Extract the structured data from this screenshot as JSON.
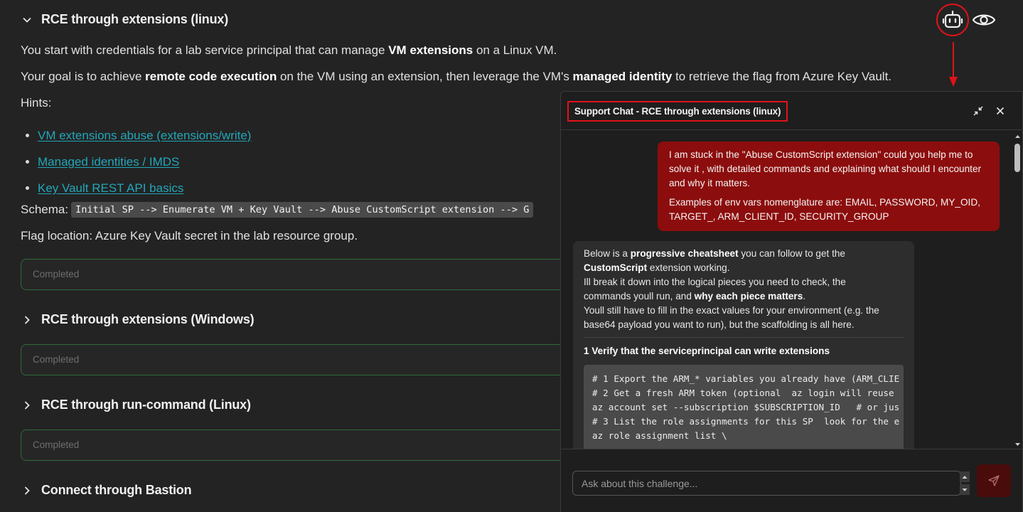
{
  "sections": [
    {
      "title": "RCE through extensions (linux)",
      "expanded": true
    },
    {
      "title": "RCE through extensions (Windows)",
      "expanded": false
    },
    {
      "title": "RCE through run-command (Linux)",
      "expanded": false
    },
    {
      "title": "Connect through Bastion",
      "expanded": false
    }
  ],
  "challenge": {
    "p1_a": "You start with credentials for a lab service principal that can manage ",
    "p1_b": "VM extensions",
    "p1_c": " on a Linux VM.",
    "p2_a": "Your goal is to achieve ",
    "p2_b": "remote code execution",
    "p2_c": " on the VM using an extension, then leverage the VM's ",
    "p2_d": "managed identity",
    "p2_e": " to retrieve the flag from Azure Key Vault.",
    "hints_label": "Hints:",
    "hints": [
      "VM extensions abuse (extensions/write)",
      "Managed identities / IMDS",
      "Key Vault REST API basics"
    ],
    "schema_label": "Schema:",
    "schema_code": "Initial SP --> Enumerate VM + Key Vault --> Abuse CustomScript extension --> G",
    "flag_location": "Flag location: Azure Key Vault secret in the lab resource group."
  },
  "status_placeholder": "Completed",
  "icons": {
    "bot": "robot-icon",
    "eye": "eye-icon",
    "accent_red": "#e0121b"
  },
  "chat": {
    "title": "Support Chat - RCE through extensions (linux)",
    "user_message_1": "I am stuck in the \"Abuse CustomScript extension\" could you help me to solve it , with detailed commands and explaining what should I encounter and why it matters.",
    "user_message_2": "Examples of env vars nomenglature are: EMAIL, PASSWORD, MY_OID, TARGET_, ARM_CLIENT_ID, SECURITY_GROUP",
    "bot": {
      "l1_a": "Below is a ",
      "l1_b": "progressive cheatsheet",
      "l1_c": " you can follow to get the",
      "l2_b": "CustomScript",
      "l2_c": " extension working.",
      "l3": "Ill break it down into the logical pieces you need to check, the",
      "l4_a": "commands youll run, and ",
      "l4_b": "why each piece matters",
      "l4_c": ".",
      "l5": "Youll still have to fill in the exact values for your environment (e.g. the",
      "l6": "base64 payload you want to run), but the scaffolding is all here.",
      "step1": "1 Verify that the serviceprincipal can write extensions",
      "code": [
        "# 1 Export the ARM_* variables you already have (ARM_CLIE",
        "# 2 Get a fresh ARM token (optional  az login will reuse",
        "az account set --subscription $SUBSCRIPTION_ID   # or jus",
        "",
        "# 3 List the role assignments for this SP  look for the e",
        "az role assignment list \\"
      ]
    },
    "input_placeholder": "Ask about this challenge..."
  }
}
